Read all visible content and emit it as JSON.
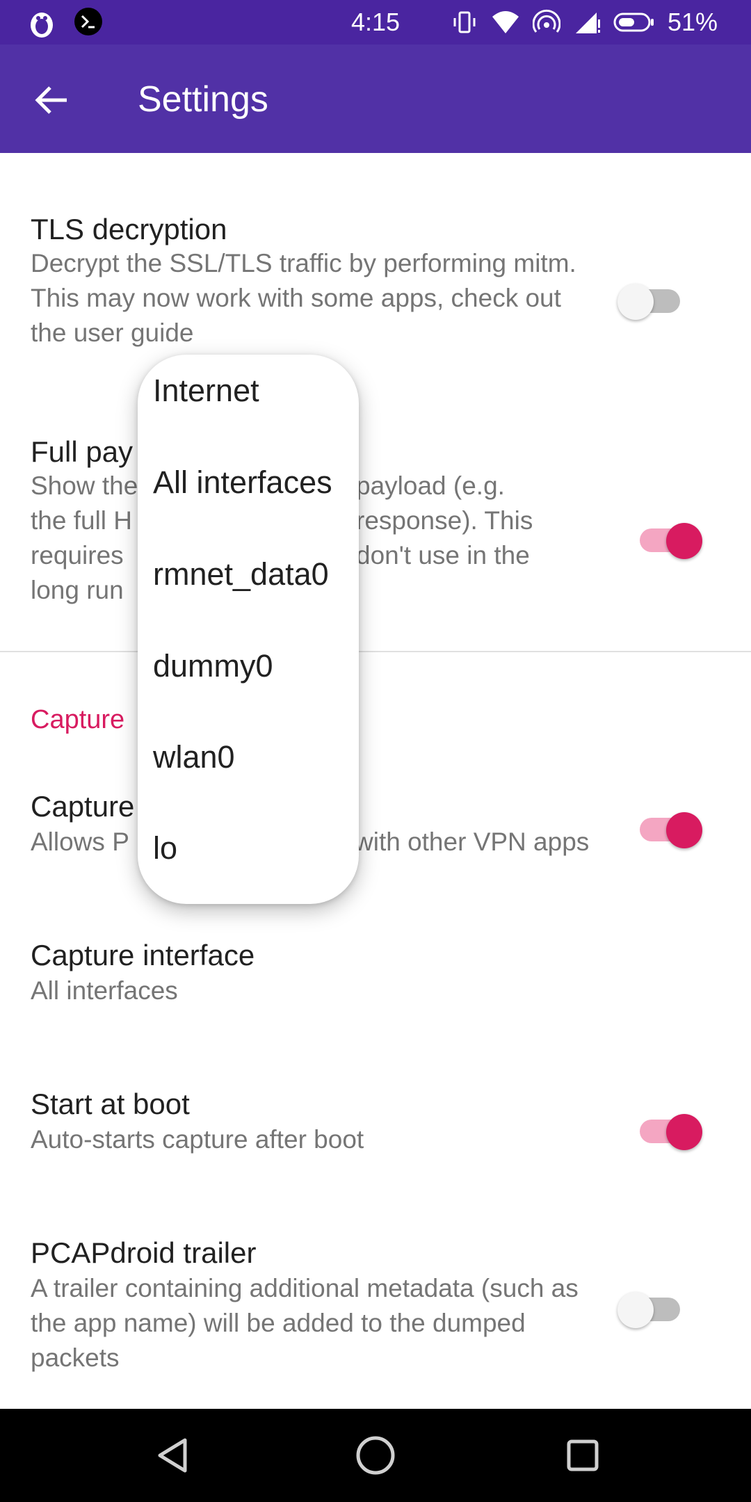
{
  "status_bar": {
    "time": "4:15",
    "battery": "51%"
  },
  "app_bar": {
    "title": "Settings"
  },
  "prefs": {
    "tls": {
      "title": "TLS decryption",
      "summary": "Decrypt the SSL/TLS traffic by performing mitm. This may now work with some apps, check out the user guide",
      "enabled": false
    },
    "payload": {
      "title": "Full pay",
      "summary_lines": [
        "Show the",
        "the full H",
        "requires",
        "long run"
      ],
      "summary_right": [
        "payload (e.g.",
        "response). This",
        "don't use in the"
      ],
      "enabled": true
    },
    "capture_section": "Capture",
    "vpn": {
      "title": "Capture",
      "summary_left": "Allows P",
      "summary_right": "with other VPN apps",
      "enabled": true
    },
    "interface": {
      "title": "Capture interface",
      "summary": "All interfaces"
    },
    "boot": {
      "title": "Start at boot",
      "summary": "Auto-starts capture after boot",
      "enabled": true
    },
    "trailer": {
      "title": "PCAPdroid trailer",
      "summary": "A trailer containing additional metadata (such as the app name) will be added to the dumped packets",
      "enabled": false
    }
  },
  "popup": {
    "items": [
      "Internet",
      "All interfaces",
      "rmnet_data0",
      "dummy0",
      "wlan0",
      "lo"
    ]
  },
  "colors": {
    "status_bar": "#4a25a0",
    "app_bar": "#5131a6",
    "accent": "#d81b60"
  },
  "icons": {
    "status_left": [
      "penguin-icon",
      "terminal-icon"
    ],
    "status_right": [
      "vibrate-icon",
      "wifi-icon",
      "hotspot-icon",
      "signal-icon",
      "battery-icon"
    ],
    "nav": [
      "back-triangle-icon",
      "home-circle-icon",
      "recents-square-icon"
    ]
  }
}
